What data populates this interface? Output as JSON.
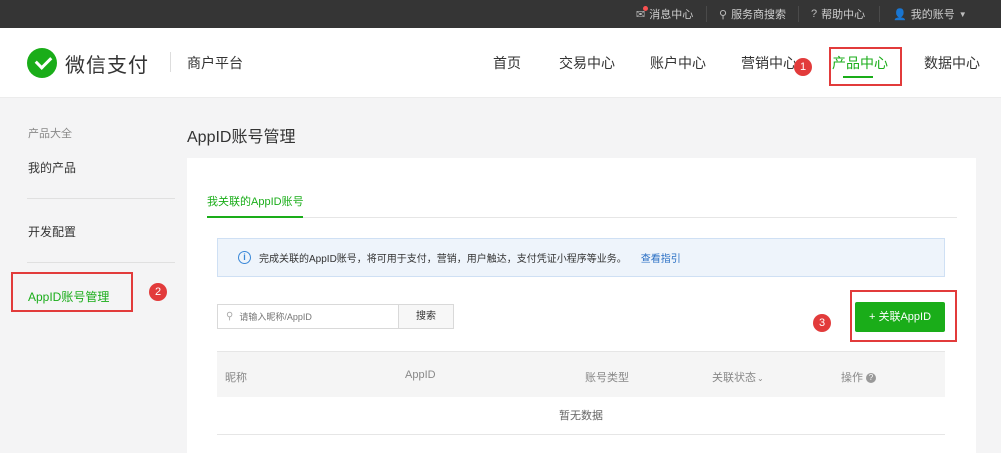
{
  "topbar": {
    "items": [
      "消息中心",
      "服务商搜索",
      "帮助中心",
      "我的账号"
    ]
  },
  "header": {
    "brand": "微信支付",
    "platform": "商户平台",
    "nav": [
      "首页",
      "交易中心",
      "账户中心",
      "营销中心",
      "产品中心",
      "数据中心"
    ],
    "active_nav": "产品中心"
  },
  "sidebar": {
    "group_title": "产品大全",
    "items": [
      "我的产品",
      "开发配置",
      "AppID账号管理"
    ],
    "active_item": "AppID账号管理"
  },
  "main": {
    "page_title": "AppID账号管理",
    "tab": "我关联的AppID账号",
    "notice": "完成关联的AppID账号，将可用于支付，营销，用户触达，支付凭证小程序等业务。",
    "notice_link": "查看指引",
    "search_placeholder": "请输入昵称/AppID",
    "search_button": "搜索",
    "add_button": "+ 关联AppID",
    "columns": [
      "昵称",
      "AppID",
      "账号类型",
      "关联状态",
      "操作"
    ],
    "empty_text": "暂无数据"
  },
  "annotations": [
    "1",
    "2",
    "3"
  ],
  "colors": {
    "accent": "#1aad19",
    "topbar_bg": "#353535",
    "highlight_red": "#e23b3b",
    "link_blue": "#2a6fc4"
  }
}
